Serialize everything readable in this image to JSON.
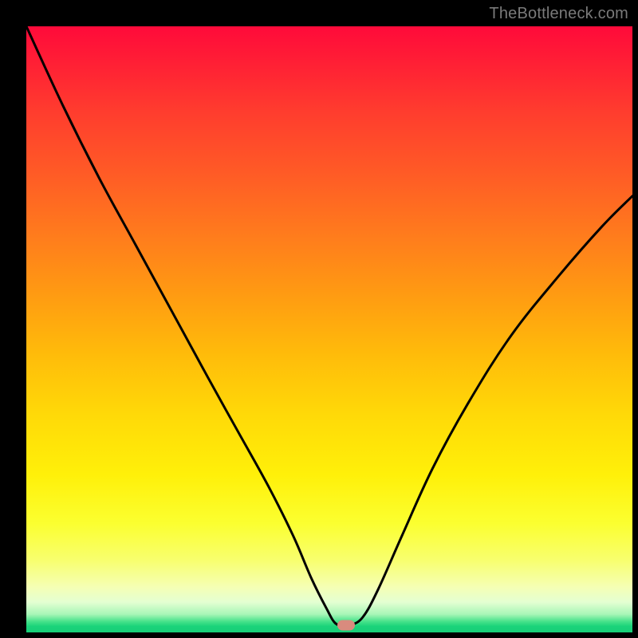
{
  "watermark": "TheBottleneck.com",
  "chart_data": {
    "type": "line",
    "title": "",
    "xlabel": "",
    "ylabel": "",
    "xlim": [
      0,
      100
    ],
    "ylim": [
      0,
      100
    ],
    "grid": false,
    "gradient_bands": [
      "red-top",
      "orange",
      "yellow",
      "pale-green",
      "green-bottom"
    ],
    "series": [
      {
        "name": "bottleneck-curve",
        "x": [
          0,
          6,
          12,
          18,
          24,
          30,
          35,
          40,
          44,
          47,
          49.5,
          51,
          52.5,
          53.5,
          55.5,
          58,
          62,
          67,
          73,
          80,
          88,
          95,
          100
        ],
        "values": [
          100,
          87,
          75,
          64,
          53,
          42,
          33,
          24,
          16,
          9,
          4,
          1.5,
          1.2,
          1.2,
          2.5,
          7,
          16,
          27,
          38,
          49,
          59,
          67,
          72
        ]
      }
    ],
    "marker": {
      "x": 52.8,
      "y": 1.2,
      "color": "#d98b7e"
    }
  }
}
